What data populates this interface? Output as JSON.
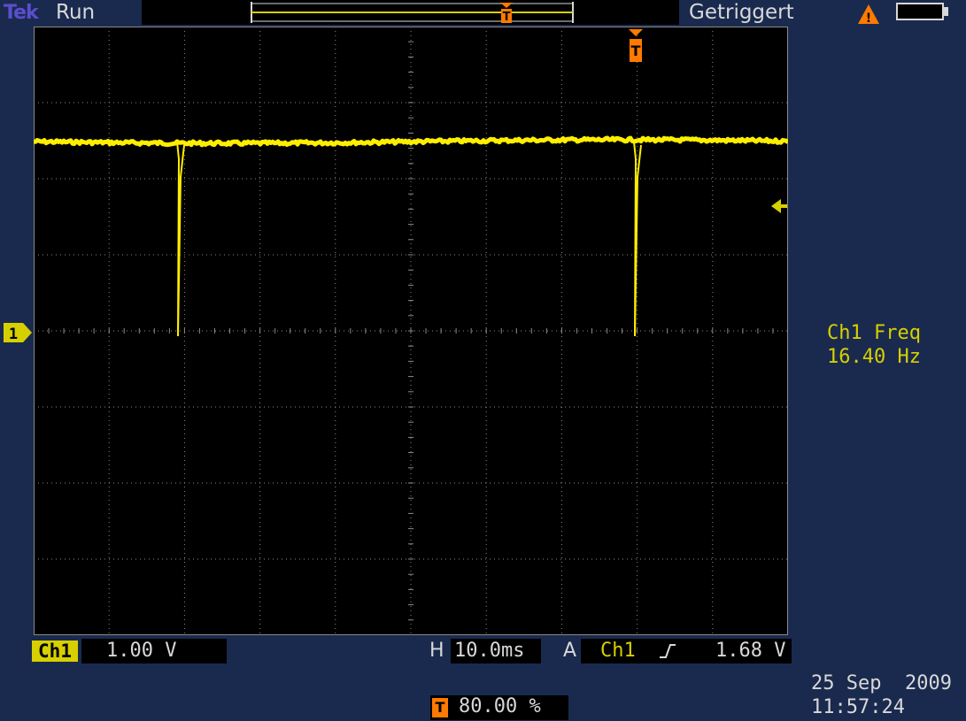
{
  "header": {
    "brand": "Tek",
    "run_state": "Run",
    "trigger_status": "Getriggert"
  },
  "channel": {
    "label": "Ch1",
    "scale": "1.00 V",
    "ground_marker": "1"
  },
  "horizontal": {
    "label": "H",
    "scale": "10.0ms"
  },
  "trigger": {
    "label": "A",
    "source": "Ch1",
    "level": "1.68 V",
    "marker": "T",
    "position": "80.00 %"
  },
  "measurement": {
    "label": "Ch1 Freq",
    "value": "16.40 Hz"
  },
  "datetime": {
    "date": "25 Sep  2009",
    "time": "11:57:24"
  },
  "colors": {
    "trace": "#ffee00",
    "channel": "#d7d000",
    "trigger": "#ff7a00",
    "grid": "#8a8a8a",
    "background": "#1a2a4e"
  }
}
